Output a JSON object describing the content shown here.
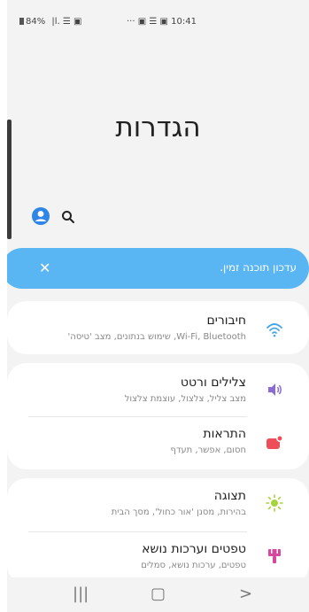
{
  "status_bar": {
    "left_text": "84% ",
    "left_icons": "|l. ☰ ▣",
    "right_text": "··· ▣ ☰ ▣ 10:41"
  },
  "page_title": "הגדרות",
  "icons": {
    "avatar": "person-circle",
    "search": "magnifier"
  },
  "banner": {
    "text": "עדכון תוכנה זמין.",
    "close_glyph": "✕",
    "color": "#5ab6f2"
  },
  "settings": [
    {
      "title": "חיבורים",
      "subtitle": "Wi-Fi, Bluetooth, שימוש בנתונים, מצב 'טיסה'",
      "icon": "wifi",
      "color": "#46a7e8"
    },
    {
      "title": "צלילים ורטט",
      "subtitle": "מצב צליל, צלצול, עוצמת צלצול",
      "icon": "speaker",
      "color": "#8d6bd6"
    },
    {
      "title": "התראות",
      "subtitle": "חסום, אפשר, תעדף",
      "icon": "notification",
      "color": "#ee4e5a"
    },
    {
      "title": "תצוגה",
      "subtitle": "בהירות, מסנן 'אור כחול', מסך הבית",
      "icon": "sun",
      "color": "#a6d33e"
    },
    {
      "title": "טפטים וערכות נושא",
      "subtitle": "טפטים, ערכות נושא, סמלים",
      "icon": "brush",
      "color": "#d9469f"
    }
  ],
  "nav": {
    "recents": "|||",
    "home": "▢",
    "back": ">"
  }
}
